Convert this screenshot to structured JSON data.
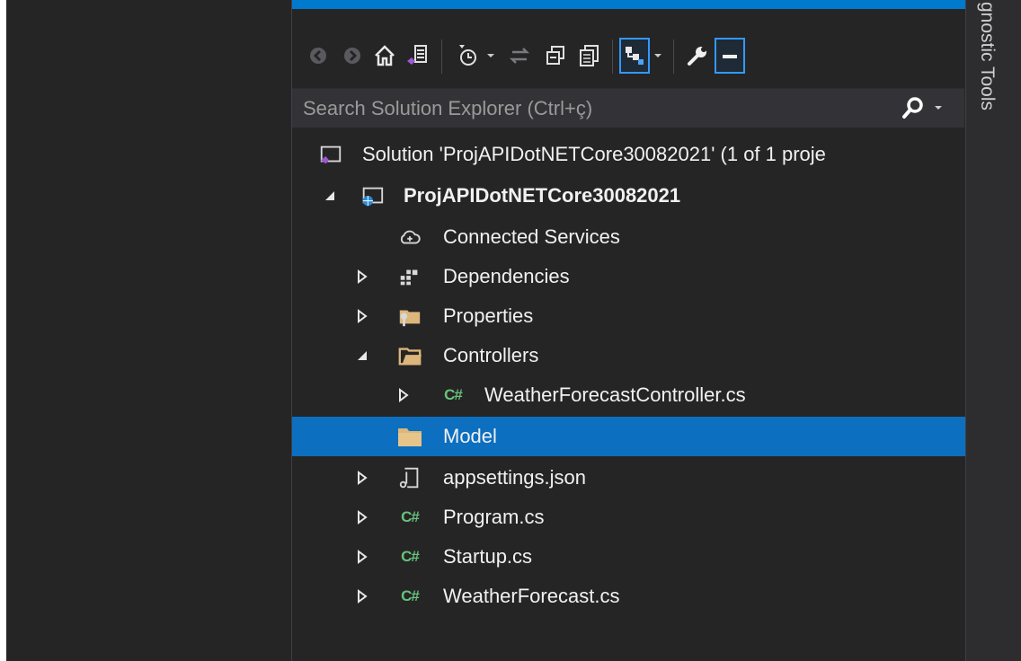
{
  "right_panel": {
    "tab_label": "gnostic Tools"
  },
  "toolbar": {
    "buttons": [
      {
        "name": "back-button",
        "icon": "back-arrow-icon"
      },
      {
        "name": "forward-button",
        "icon": "forward-arrow-icon"
      },
      {
        "name": "home-button",
        "icon": "home-icon"
      },
      {
        "name": "switch-views-button",
        "icon": "vs-switch-views-icon"
      },
      {
        "name": "pending-changes-filter-button",
        "icon": "clock-filter-icon"
      },
      {
        "name": "sync-active-document-button",
        "icon": "sync-arrows-icon"
      },
      {
        "name": "collapse-all-button",
        "icon": "collapse-all-icon"
      },
      {
        "name": "show-all-files-button",
        "icon": "show-all-files-icon"
      },
      {
        "name": "preview-selected-button",
        "icon": "tree-view-icon"
      },
      {
        "name": "properties-button",
        "icon": "wrench-icon"
      },
      {
        "name": "preview-toggle-button",
        "icon": "minus-box-icon"
      }
    ]
  },
  "search": {
    "placeholder": "Search Solution Explorer (Ctrl+ç)"
  },
  "tree": {
    "solution": "Solution 'ProjAPIDotNETCore30082021' (1 of 1 proje",
    "project": "ProjAPIDotNETCore30082021",
    "connected_services": "Connected Services",
    "dependencies": "Dependencies",
    "properties": "Properties",
    "controllers": "Controllers",
    "controller_file": "WeatherForecastController.cs",
    "model": "Model",
    "appsettings": "appsettings.json",
    "program": "Program.cs",
    "startup": "Startup.cs",
    "weather": "WeatherForecast.cs",
    "cs_badge": "C#"
  },
  "colors": {
    "panel_bg": "#252526",
    "selection": "#0c6fc0",
    "accent": "#007acc",
    "csharp_green": "#68c27a",
    "folder_yellow": "#dcb67a"
  }
}
